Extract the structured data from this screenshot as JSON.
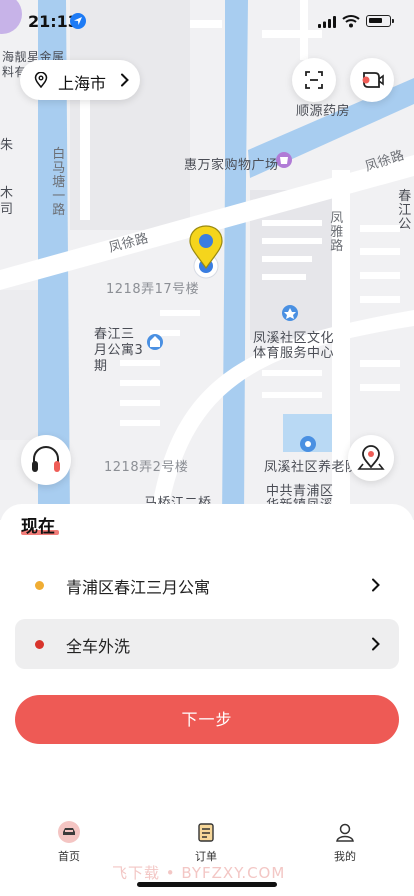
{
  "status_bar": {
    "time": "21:13"
  },
  "map": {
    "city": "上海市",
    "labels": {
      "shop_top": "海靓星金属",
      "shop_top2": "料有",
      "road_baima": "白马塘一路",
      "road_fengxu_left": "凤徐路",
      "road_fengxu_right": "凤徐路",
      "road_fengya": "凤雅路",
      "pharmacy": "顺源药房",
      "mall": "惠万家购物广场",
      "lane17": "1218弄17号楼",
      "apartment": "春江三月公寓3期",
      "culture_center_1": "凤溪社区文化",
      "culture_center_2": "体育服务中心",
      "lane2": "1218弄2号楼",
      "elder_home": "凤溪社区养老院",
      "party_1": "中共青浦区",
      "party_2": "华新镇凤溪",
      "bridge": "马桥江二桥",
      "edge_left_1": "朱",
      "edge_left_2": "木",
      "edge_left_3": "司",
      "edge_right": "春江公"
    }
  },
  "sheet": {
    "title": "现在",
    "address": "青浦区春江三月公寓",
    "service": "全车外洗",
    "next_button": "下一步"
  },
  "tabs": [
    {
      "label": "首页"
    },
    {
      "label": "订单"
    },
    {
      "label": "我的"
    }
  ],
  "watermark": "飞下载 • BYFZXY.COM",
  "colors": {
    "accent_red": "#ee5a55",
    "address_dot": "#f0ad33",
    "service_dot": "#d8342c",
    "river": "#a8cdf0",
    "marker_yellow": "#f5d51c",
    "marker_blue": "#3a7de0"
  }
}
